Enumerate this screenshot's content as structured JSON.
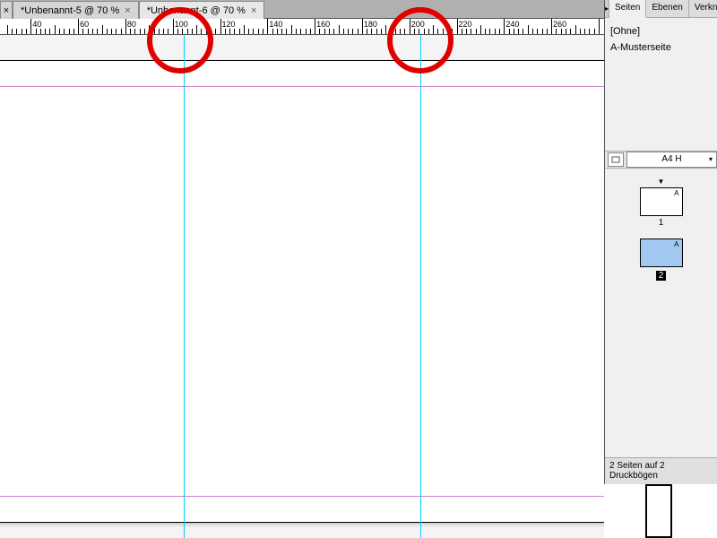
{
  "tabs": {
    "items": [
      {
        "title": "*Unbenannt-5 @ 70 %"
      },
      {
        "title": "*Unbenannt-6 @ 70 %"
      }
    ],
    "active_index": 1
  },
  "ruler": {
    "labels": [
      40,
      60,
      80,
      100,
      120,
      140,
      160,
      180,
      200,
      220,
      240,
      260
    ]
  },
  "guides": {
    "vertical_positions_mm": [
      105,
      205
    ]
  },
  "panel": {
    "tabs": [
      "Seiten",
      "Ebenen",
      "Verkn"
    ],
    "active_tab": "Seiten",
    "masters": {
      "none_label": "[Ohne]",
      "master_a": "A-Musterseite"
    },
    "page_size": "A4 H",
    "pages": [
      {
        "master": "A",
        "number": "1",
        "selected": false
      },
      {
        "master": "A",
        "number": "2",
        "selected": true
      }
    ],
    "footer": "2 Seiten auf 2 Druckbögen"
  }
}
